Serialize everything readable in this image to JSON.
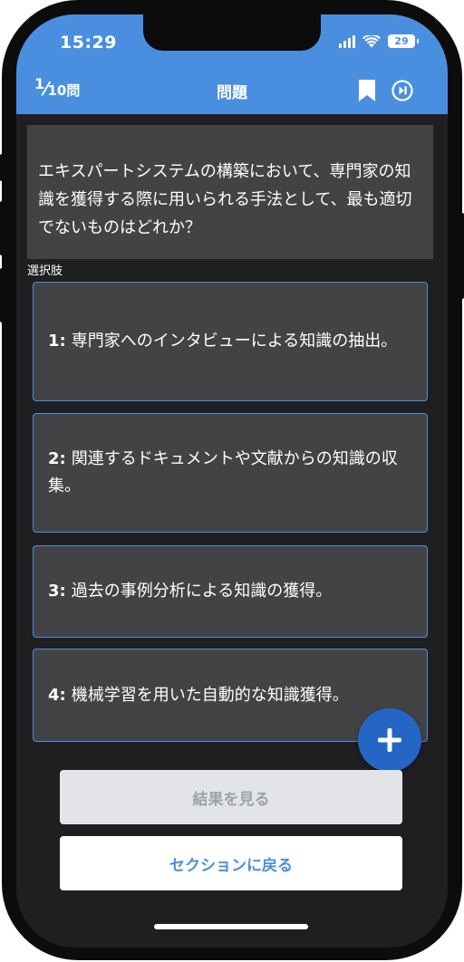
{
  "status": {
    "time": "15:29",
    "battery": "29"
  },
  "nav": {
    "current": "1",
    "total": "10問",
    "title": "問題"
  },
  "question": {
    "text": "エキスパートシステムの構築において、専門家の知識を獲得する際に用いられる手法として、最も適切でないものはどれか？"
  },
  "choices_label": "選択肢",
  "choices": [
    {
      "num": "1:",
      "text": "専門家へのインタビューによる知識の抽出。"
    },
    {
      "num": "2:",
      "text": "関連するドキュメントや文献からの知識の収集。"
    },
    {
      "num": "3:",
      "text": "過去の事例分析による知識の獲得。"
    },
    {
      "num": "4:",
      "text": "機械学習を用いた自動的な知識獲得。"
    }
  ],
  "buttons": {
    "results": "結果を見る",
    "back": "セクションに戻る"
  },
  "colors": {
    "accent": "#4a8fdf",
    "fab": "#2566c4",
    "card": "#434345",
    "background": "#1f1f21"
  },
  "icons": {
    "bookmark": "bookmark-icon",
    "skip": "skip-forward-icon",
    "add": "plus-icon"
  }
}
